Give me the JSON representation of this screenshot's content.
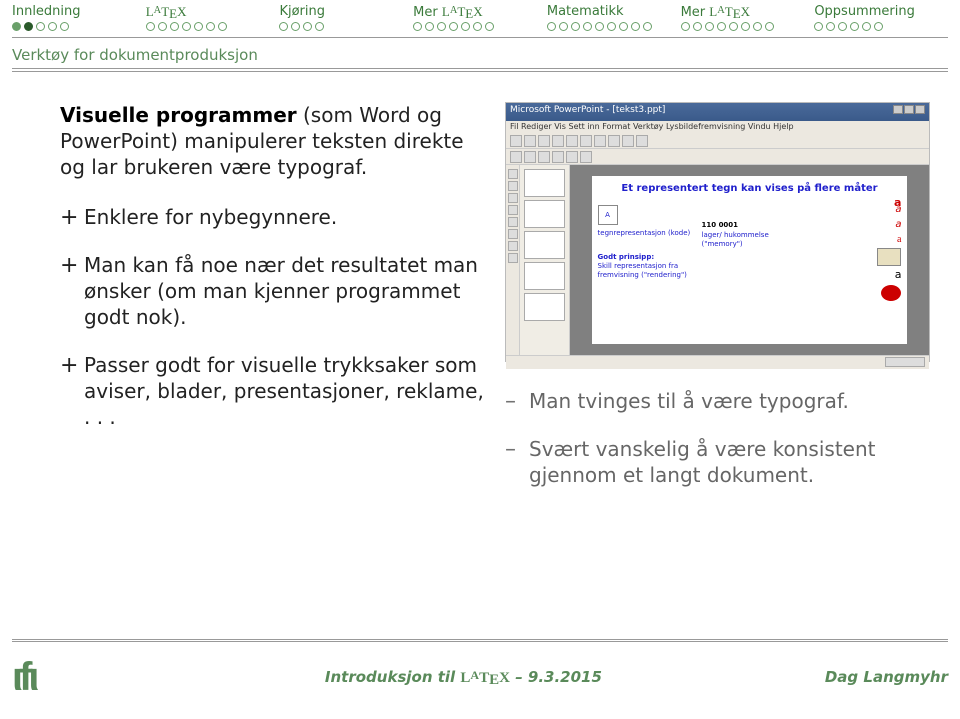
{
  "nav": {
    "items": [
      {
        "label": "Innledning",
        "dots": 5,
        "current": 1
      },
      {
        "label": "LATEX",
        "latex": true,
        "dots": 7,
        "current": -1
      },
      {
        "label": "Kjøring",
        "dots": 4,
        "current": -1
      },
      {
        "label": "Mer LATEX",
        "latex": true,
        "dots": 7,
        "current": -1
      },
      {
        "label": "Matematikk",
        "dots": 9,
        "current": -1
      },
      {
        "label": "Mer LATEX",
        "latex": true,
        "dots": 8,
        "current": -1
      },
      {
        "label": "Oppsummering",
        "dots": 6,
        "current": -1
      }
    ]
  },
  "section_title": "Verktøy for dokumentproduksjon",
  "intro": {
    "bold": "Visuelle programmer",
    "rest": " (som Word og PowerPoint) manipulerer teksten direkte og lar brukeren være typograf."
  },
  "plus_items": [
    "Enklere for nybegynnere.",
    "Man kan få noe nær det resultatet man ønsker (om man kjenner programmet godt nok).",
    "Passer godt for visuelle trykksaker som aviser, blader, presentasjoner, reklame, . . ."
  ],
  "minus_items": [
    "Man tvinges til å være typograf.",
    "Svært vanskelig å være konsistent gjennom et langt dokument."
  ],
  "figure": {
    "window_title": "Microsoft PowerPoint - [tekst3.ppt]",
    "menu": "Fil  Rediger  Vis  Sett inn  Format  Verktøy  Lysbildefremvisning  Vindu  Hjelp",
    "slide_title": "Et representert tegn kan vises på flere måter",
    "slide_label_left": "tegnrepresentasjon (kode)",
    "slide_110": "110 0001",
    "slide_lager": "lager/ hukommelse (\"memory\")",
    "slide_godt": "Godt prinsipp:",
    "slide_skill": "Skill representasjon fra fremvisning (\"rendering\")",
    "a": "a"
  },
  "footer": {
    "center_prefix": "Introduksjon til ",
    "center_latex": "LATEX",
    "center_date": " – 9.3.2015",
    "right": "Dag Langmyhr",
    "logo": "ιfι"
  }
}
